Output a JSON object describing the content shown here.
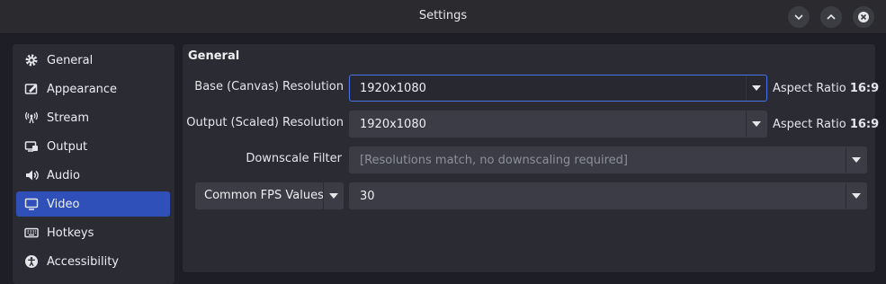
{
  "window": {
    "title": "Settings",
    "controls": [
      "minimize",
      "maximize",
      "close"
    ]
  },
  "sidebar": {
    "items": [
      {
        "label": "General",
        "icon": "gear-icon",
        "active": false
      },
      {
        "label": "Appearance",
        "icon": "appearance-icon",
        "active": false
      },
      {
        "label": "Stream",
        "icon": "broadcast-icon",
        "active": false
      },
      {
        "label": "Output",
        "icon": "output-icon",
        "active": false
      },
      {
        "label": "Audio",
        "icon": "speaker-icon",
        "active": false
      },
      {
        "label": "Video",
        "icon": "monitor-icon",
        "active": true
      },
      {
        "label": "Hotkeys",
        "icon": "keyboard-icon",
        "active": false
      },
      {
        "label": "Accessibility",
        "icon": "accessibility-icon",
        "active": false
      }
    ]
  },
  "panel": {
    "section_title": "General",
    "base_resolution": {
      "label": "Base (Canvas) Resolution",
      "value": "1920x1080",
      "aspect_prefix": "Aspect Ratio",
      "aspect_value": "16:9"
    },
    "output_resolution": {
      "label": "Output (Scaled) Resolution",
      "value": "1920x1080",
      "aspect_prefix": "Aspect Ratio",
      "aspect_value": "16:9"
    },
    "downscale_filter": {
      "label": "Downscale Filter",
      "value": "[Resolutions match, no downscaling required]"
    },
    "fps": {
      "type_label": "Common FPS Values",
      "value": "30"
    }
  },
  "colors": {
    "accent": "#2f4fb9",
    "focus_border": "#4a73e8",
    "panel_bg": "#2a2b33",
    "window_bg": "#1e1f26"
  }
}
